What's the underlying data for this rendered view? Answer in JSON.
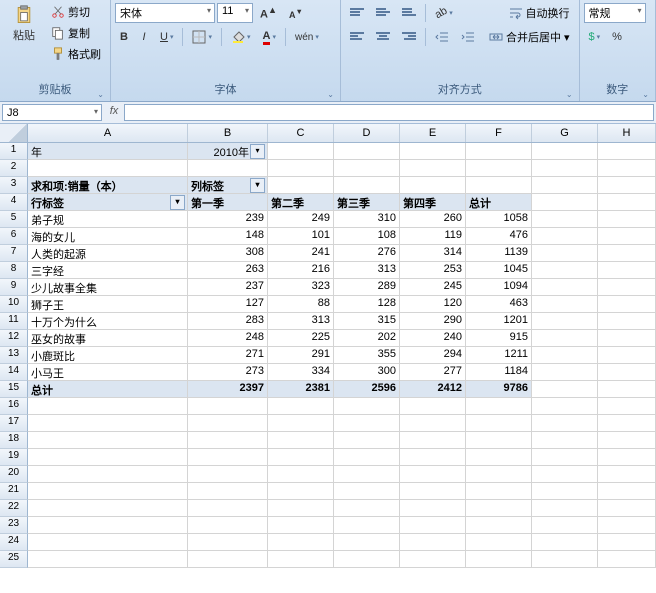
{
  "ribbon": {
    "clipboard": {
      "paste": "粘贴",
      "cut": "剪切",
      "copy": "复制",
      "format_painter": "格式刷",
      "label": "剪贴板"
    },
    "font": {
      "name": "宋体",
      "size": "11",
      "label": "字体",
      "bold": "B",
      "italic": "I",
      "underline": "U"
    },
    "align": {
      "label": "对齐方式",
      "wrap": "自动换行",
      "merge": "合并后居中"
    },
    "number": {
      "label": "数字",
      "format": "常规",
      "percent": "%"
    }
  },
  "namebox": "J8",
  "formula": "",
  "columns": [
    "A",
    "B",
    "C",
    "D",
    "E",
    "F",
    "G",
    "H"
  ],
  "pivot": {
    "filter_label": "年",
    "filter_value": "2010年",
    "data_field": "求和项:销量（本）",
    "col_label": "列标签",
    "row_label": "行标签",
    "headers": [
      "第一季",
      "第二季",
      "第三季",
      "第四季",
      "总计"
    ],
    "rows": [
      {
        "name": "弟子规",
        "v": [
          239,
          249,
          310,
          260,
          1058
        ]
      },
      {
        "name": "海的女儿",
        "v": [
          148,
          101,
          108,
          119,
          476
        ]
      },
      {
        "name": "人类的起源",
        "v": [
          308,
          241,
          276,
          314,
          1139
        ]
      },
      {
        "name": "三字经",
        "v": [
          263,
          216,
          313,
          253,
          1045
        ]
      },
      {
        "name": "少儿故事全集",
        "v": [
          237,
          323,
          289,
          245,
          1094
        ]
      },
      {
        "name": "狮子王",
        "v": [
          127,
          88,
          128,
          120,
          463
        ]
      },
      {
        "name": "十万个为什么",
        "v": [
          283,
          313,
          315,
          290,
          1201
        ]
      },
      {
        "name": "巫女的故事",
        "v": [
          248,
          225,
          202,
          240,
          915
        ]
      },
      {
        "name": "小鹿斑比",
        "v": [
          271,
          291,
          355,
          294,
          1211
        ]
      },
      {
        "name": "小马王",
        "v": [
          273,
          334,
          300,
          277,
          1184
        ]
      }
    ],
    "total_label": "总计",
    "totals": [
      2397,
      2381,
      2596,
      2412,
      9786
    ]
  },
  "chart_data": {
    "type": "table",
    "title": "求和项:销量（本）",
    "filter": {
      "年": "2010年"
    },
    "columns": [
      "第一季",
      "第二季",
      "第三季",
      "第四季",
      "总计"
    ],
    "rows": [
      "弟子规",
      "海的女儿",
      "人类的起源",
      "三字经",
      "少儿故事全集",
      "狮子王",
      "十万个为什么",
      "巫女的故事",
      "小鹿斑比",
      "小马王",
      "总计"
    ],
    "values": [
      [
        239,
        249,
        310,
        260,
        1058
      ],
      [
        148,
        101,
        108,
        119,
        476
      ],
      [
        308,
        241,
        276,
        314,
        1139
      ],
      [
        263,
        216,
        313,
        253,
        1045
      ],
      [
        237,
        323,
        289,
        245,
        1094
      ],
      [
        127,
        88,
        128,
        120,
        463
      ],
      [
        283,
        313,
        315,
        290,
        1201
      ],
      [
        248,
        225,
        202,
        240,
        915
      ],
      [
        271,
        291,
        355,
        294,
        1211
      ],
      [
        273,
        334,
        300,
        277,
        1184
      ],
      [
        2397,
        2381,
        2596,
        2412,
        9786
      ]
    ]
  }
}
